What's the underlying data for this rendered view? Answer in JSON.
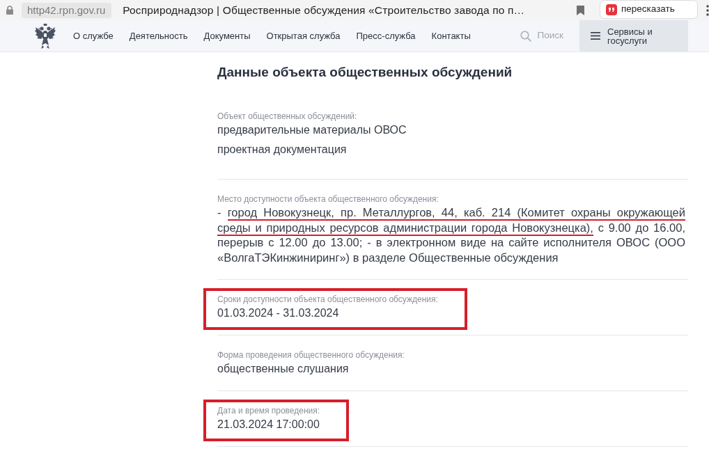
{
  "browser": {
    "url": "http42.rpn.gov.ru",
    "tab_title": "Росприроднадзор | Общественные обсуждения «Строительство завода по п…",
    "retell_button": "пересказать"
  },
  "nav": {
    "items": [
      "О службе",
      "Деятельность",
      "Документы",
      "Открытая служба",
      "Пресс-служба",
      "Контакты"
    ],
    "search": "Поиск",
    "services_button": "Сервисы и госуслуги"
  },
  "page_title": "Данные объекта общественных обсуждений",
  "sections": [
    {
      "kind": "list",
      "label": "Объект общественных обсуждений:",
      "values": [
        "предварительные материалы ОВОС",
        "проектная документация"
      ],
      "boxed": false
    },
    {
      "kind": "annotated",
      "label": "Место доступности объекта общественного обсуждения:",
      "parts": [
        {
          "text": "- ",
          "marked": false
        },
        {
          "text": "город Новокузнецк, пр. Металлургов, 44, каб. 214 (Комитет охраны окружающей среды и природных ресурсов администрации города Новокузнецка),",
          "marked": true
        },
        {
          "text": " с 9.00 до 16.00, перерыв с 12.00 до 13.00; - в электронном виде на сайте исполнителя ОВОС (ООО «ВолгаТЭКинжиниринг») в разделе Общественные обсуждения",
          "marked": false
        }
      ],
      "boxed": false
    },
    {
      "kind": "list",
      "label": "Сроки доступности объекта общественного обсуждения:",
      "values": [
        "01.03.2024 - 31.03.2024"
      ],
      "boxed": true
    },
    {
      "kind": "list",
      "label": "Форма проведения общественного обсуждения:",
      "values": [
        "общественные слушания"
      ],
      "boxed": false
    },
    {
      "kind": "list",
      "label": "Дата и время проведения:",
      "values": [
        "21.03.2024 17:00:00"
      ],
      "boxed": true
    }
  ]
}
